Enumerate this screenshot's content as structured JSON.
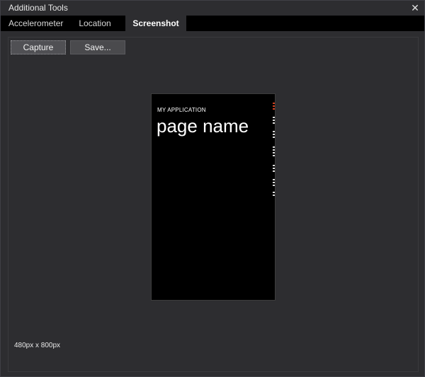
{
  "window": {
    "title": "Additional Tools",
    "close_glyph": "✕"
  },
  "tabs": [
    {
      "label": "Accelerometer",
      "active": false
    },
    {
      "label": "Location",
      "active": false
    },
    {
      "label": "Screenshot",
      "active": true
    }
  ],
  "toolbar": {
    "capture_label": "Capture",
    "save_label": "Save..."
  },
  "preview": {
    "app_title": "MY APPLICATION",
    "page_name": "page name"
  },
  "status": {
    "resolution": "480px x 800px"
  },
  "colors": {
    "background": "#2d2d30",
    "tabstrip": "#000000",
    "accent_red": "#d04020"
  }
}
